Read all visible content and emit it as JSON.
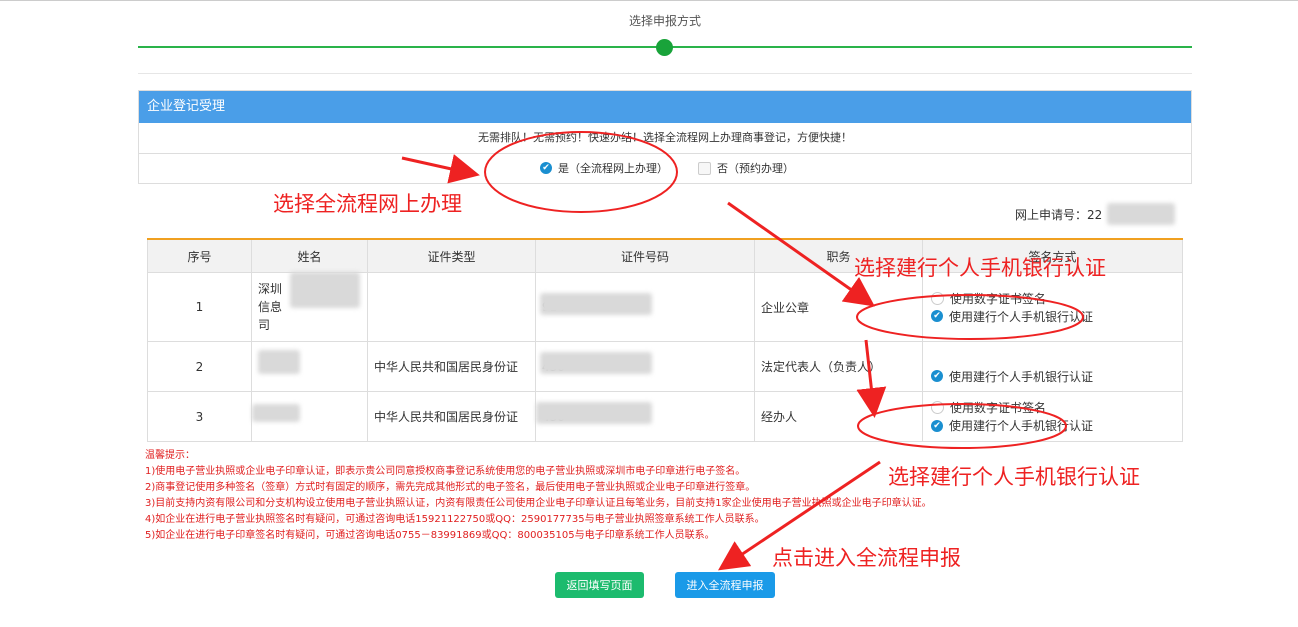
{
  "step": {
    "title": "选择申报方式"
  },
  "panel": {
    "title": "企业登记受理",
    "notice": "无需排队！无需预约！快速办结！选择全流程网上办理商事登记，方便快捷！",
    "option_yes": "是（全流程网上办理）",
    "option_no": "否（预约办理）"
  },
  "application_no": {
    "label": "网上申请号：",
    "value": "22"
  },
  "table": {
    "headers": [
      "序号",
      "姓名",
      "证件类型",
      "证件号码",
      "职务",
      "签名方式"
    ],
    "rows": [
      {
        "no": "1",
        "name": "深圳\n信息\n司",
        "id_type": "",
        "id_code": "914",
        "role": "企业公章",
        "options": [
          {
            "label": "使用数字证书签名",
            "checked": false
          },
          {
            "label": "使用建行个人手机银行认证",
            "checked": true
          }
        ]
      },
      {
        "no": "2",
        "name": "",
        "id_type": "中华人民共和国居民身份证",
        "id_code": "430",
        "role": "法定代表人（负责人）",
        "options": [
          {
            "label": "使用建行个人手机银行认证",
            "checked": true
          }
        ]
      },
      {
        "no": "3",
        "name": "",
        "id_type": "中华人民共和国居民身份证",
        "id_code": "430",
        "role": "经办人",
        "options": [
          {
            "label": "使用数字证书签名",
            "checked": false
          },
          {
            "label": "使用建行个人手机银行认证",
            "checked": true
          }
        ]
      }
    ]
  },
  "tips": [
    "温馨提示：",
    "1)使用电子营业执照或企业电子印章认证，即表示贵公司同意授权商事登记系统使用您的电子营业执照或深圳市电子印章进行电子签名。",
    "2)商事登记使用多种签名（签章）方式时有固定的顺序，需先完成其他形式的电子签名，最后使用电子营业执照或企业电子印章进行签章。",
    "3)目前支持内资有限公司和分支机构设立使用电子营业执照认证，内资有限责任公司使用企业电子印章认证且每笔业务，目前支持1家企业使用电子营业执照或企业电子印章认证。",
    "4)如企业在进行电子营业执照签名时有疑问，可通过咨询电话15921122750或QQ：2590177735与电子营业执照签章系统工作人员联系。",
    "5)如企业在进行电子印章签名时有疑问，可通过咨询电话0755－83991869或QQ：800035105与电子印章系统工作人员联系。"
  ],
  "buttons": {
    "back": "返回填写页面",
    "enter": "进入全流程申报"
  },
  "annotations": {
    "a1": "选择全流程网上办理",
    "a2": "选择建行个人手机银行认证",
    "a3": "选择建行个人手机银行认证",
    "a4": "点击进入全流程申报"
  },
  "colors": {
    "accent": "#4a9ee8",
    "step": "#19a33a",
    "annotation": "#ee2222",
    "tip": "#e02020",
    "back_button": "#1cbb6e",
    "enter_button": "#1a9ae8"
  }
}
